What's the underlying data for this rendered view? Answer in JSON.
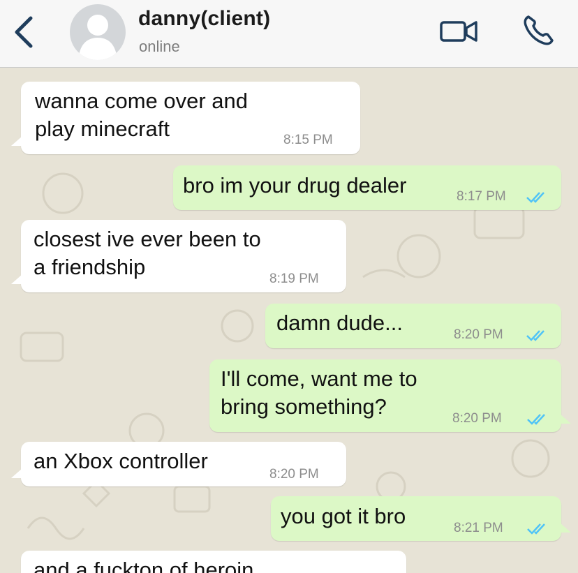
{
  "header": {
    "contact_name": "danny(client)",
    "status": "online",
    "icons": {
      "back": "chevron-left-icon",
      "avatar": "default-avatar-icon",
      "video": "video-camera-icon",
      "call": "phone-icon"
    }
  },
  "messages": [
    {
      "direction": "in",
      "text": "wanna come over and\nplay minecraft",
      "time": "8:15 PM"
    },
    {
      "direction": "out",
      "text": "bro im your drug dealer",
      "time": "8:17 PM",
      "status": "read"
    },
    {
      "direction": "in",
      "text": "closest ive ever been to\na friendship",
      "time": "8:19 PM"
    },
    {
      "direction": "out",
      "text": "damn dude...",
      "time": "8:20 PM",
      "status": "read"
    },
    {
      "direction": "out",
      "text": "I'll come, want me to\nbring something?",
      "time": "8:20 PM",
      "status": "read"
    },
    {
      "direction": "in",
      "text": "an Xbox controller",
      "time": "8:20 PM"
    },
    {
      "direction": "out",
      "text": "you got it bro",
      "time": "8:21 PM",
      "status": "read"
    },
    {
      "direction": "in",
      "text": "and a fuckton of heroin",
      "time": ""
    }
  ],
  "colors": {
    "incoming_bubble": "#ffffff",
    "outgoing_bubble": "#dcf8c6",
    "read_ticks": "#4fc3f7",
    "chat_background": "#e7e3d6"
  }
}
